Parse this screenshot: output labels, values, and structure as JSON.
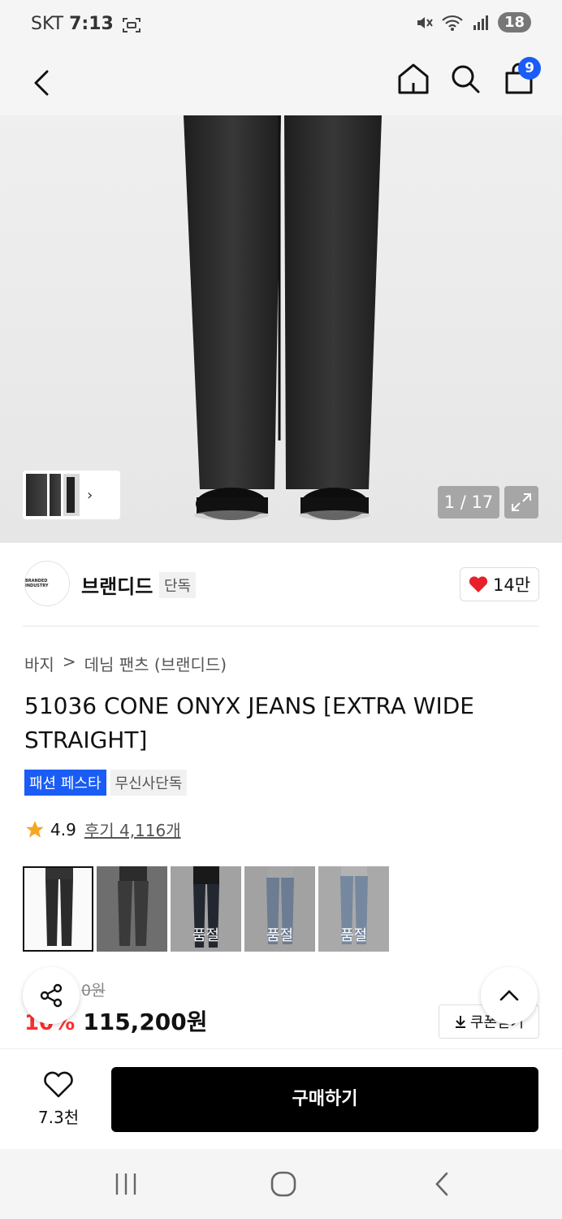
{
  "status_bar": {
    "carrier": "SKT",
    "time": "7:13",
    "battery": "18"
  },
  "app_bar": {
    "cart_count": "9"
  },
  "gallery": {
    "counter": "1 / 17"
  },
  "brand": {
    "logo_text": "BRANDED INDUSTRY",
    "name": "브랜디드",
    "tag": "단독",
    "likes": "14만"
  },
  "breadcrumb": {
    "category": "바지",
    "separator": ">",
    "subcategory": "데님 팬츠 (브랜디드)"
  },
  "product": {
    "title": "51036 CONE ONYX JEANS [EXTRA WIDE STRAIGHT]",
    "badges": [
      "패션 페스타",
      "무신사단독"
    ],
    "rating": "4.9",
    "reviews": "후기 4,116개"
  },
  "colors": [
    {
      "label": "",
      "sold_out": false,
      "color": "#2b2b2b"
    },
    {
      "label": "",
      "sold_out": false,
      "color": "#3a3a3a"
    },
    {
      "label": "품절",
      "sold_out": true,
      "color": "#2f3440"
    },
    {
      "label": "품절",
      "sold_out": true,
      "color": "#8fa6c4"
    },
    {
      "label": "품절",
      "sold_out": true,
      "color": "#9db6d4"
    }
  ],
  "price": {
    "original": "0원",
    "discount": "10%",
    "sale": "115,200원",
    "coupon_label": "쿠폰받기"
  },
  "bottom": {
    "wish_count": "7.3천",
    "buy_label": "구매하기"
  },
  "colors_theme": {
    "accent_blue": "#1a5cf5",
    "discount_red": "#ff2d2d",
    "heart_red": "#e8202a"
  }
}
